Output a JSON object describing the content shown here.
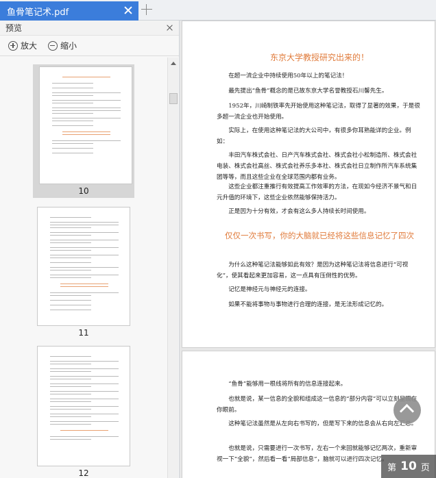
{
  "tab": {
    "title": "鱼骨笔记术.pdf"
  },
  "panel": {
    "title": "预览",
    "zoom_in": "放大",
    "zoom_out": "缩小"
  },
  "thumbnails": [
    {
      "page": "10",
      "selected": true
    },
    {
      "page": "11",
      "selected": false
    },
    {
      "page": "12",
      "selected": false
    }
  ],
  "doc": {
    "page1": {
      "title": "东京大学教授研究出来的！",
      "paragraphs": [
        "在超一流企业中持续使用50年以上的笔记法！",
        "最先提出“鱼骨”概念的是已故东京大学名誉教授石川馨先生。",
        "1952年，川崎制铁率先开始使用这种笔记法，取得了显著的效果，于是很多超一流企业也开始使用。",
        "实际上，在使用这种笔记法的大公司中，有很多你耳熟能详的企业。例如：",
        "丰田汽车株式会社、日产汽车株式会社、株式会社小松制造所、株式会社电装、株式会社高丝、株式会社养乐多本社、株式会社日立制作所汽车系统集团等等，而且这些企业在全球范围内都有业务。",
        "这些企业都注重推行有效提高工作效率的方法，在现如今经济不景气和日元升值的环境下，这些企业依然能够保持活力。",
        "正是因为十分有效，才会有这么多人持续长时间使用。"
      ],
      "heading2": "仅仅一次书写，你的大脑就已经将这些信息记忆了四次",
      "paragraphs2": [
        "为什么这种笔记法能够如此有效？是因为这种笔记法将信息进行“可视化”，使其看起来更加容易，这一点具有压倒性的优势。",
        "记忆是神经元与神经元的连接。",
        "如果不能将事物与事物进行合理的连接，是无法形成记忆的。"
      ]
    },
    "page2": {
      "paragraphs": [
        "“鱼骨”能够用一根线将所有的信息连接起来。",
        "也就是说，某一信息的全貌和组成这一信息的“部分内容”可以立刻呈现在你眼前。",
        "这种笔记法虽然是从左向右书写的，但是写下来的信息会从右向左汇总。",
        "也就是说，只需要进行一次书写，左右一个来回就能够记忆两次，重新审视一下“全貌”，然后看一看“局部信息”，脑就可以进行四次记忆。"
      ]
    }
  },
  "page_indicator": {
    "prefix": "第",
    "current": "10",
    "suffix": "页"
  },
  "colors": {
    "accent": "#3b7ddb",
    "heading": "#e07a3a"
  }
}
